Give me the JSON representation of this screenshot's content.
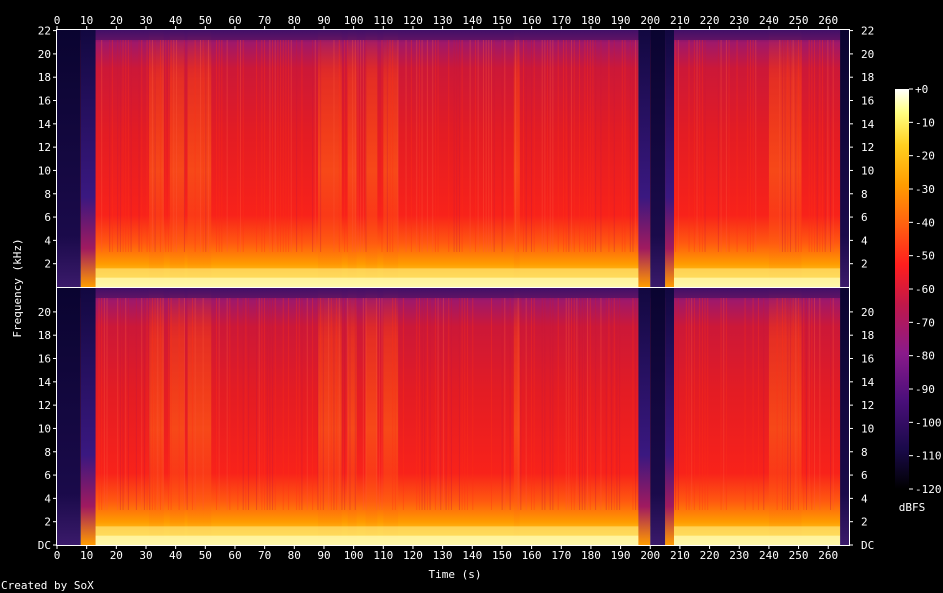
{
  "chart_data": {
    "type": "heatmap",
    "subtype": "spectrogram",
    "xlabel": "Time (s)",
    "ylabel": "Frequency (kHz)",
    "colorbar_label": "dBFS",
    "credit": "Created by SoX",
    "x_range": [
      0,
      267
    ],
    "y_range_khz": [
      0,
      22.05
    ],
    "x_ticks": [
      0,
      10,
      20,
      30,
      40,
      50,
      60,
      70,
      80,
      90,
      100,
      110,
      120,
      130,
      140,
      150,
      160,
      170,
      180,
      190,
      200,
      210,
      220,
      230,
      240,
      250,
      260
    ],
    "x_tick_labels": [
      "0",
      "10",
      "20",
      "30",
      "40",
      "50",
      "60",
      "70",
      "80",
      "90",
      "100",
      "110",
      "120",
      "130",
      "140",
      "150",
      "160",
      "170",
      "180",
      "190",
      "200",
      "210",
      "220",
      "230",
      "240",
      "250",
      "260"
    ],
    "channel_top_ticks": [
      2,
      4,
      6,
      8,
      10,
      12,
      14,
      16,
      18,
      20,
      22
    ],
    "channel_top_tick_labels": [
      "2",
      "4",
      "6",
      "8",
      "10",
      "12",
      "14",
      "16",
      "18",
      "20",
      "22"
    ],
    "channel_bottom_ticks": [
      0,
      2,
      4,
      6,
      8,
      10,
      12,
      14,
      16,
      18,
      20
    ],
    "channel_bottom_tick_labels": [
      "DC",
      "2",
      "4",
      "6",
      "8",
      "10",
      "12",
      "14",
      "16",
      "18",
      "20"
    ],
    "colorbar_ticks": [
      0,
      -10,
      -20,
      -30,
      -40,
      -50,
      -60,
      -70,
      -80,
      -90,
      -100,
      -110,
      -120
    ],
    "colorbar_tick_labels": [
      "+0",
      "-10",
      "-20",
      "-30",
      "-40",
      "-50",
      "-60",
      "-70",
      "-80",
      "-90",
      "-100",
      "-110",
      "-120"
    ],
    "colorbar_range_db": [
      -120,
      0
    ],
    "colormap": [
      "#000000",
      "#1a0a4a",
      "#4a0f7a",
      "#8a1a8a",
      "#c0184a",
      "#ff1e1e",
      "#ff6010",
      "#ff9c00",
      "#ffd020",
      "#ffff80",
      "#ffffff"
    ],
    "channels": 2,
    "silent_intervals_s": [
      [
        0,
        8
      ],
      [
        200,
        205
      ],
      [
        264,
        267
      ]
    ],
    "quiet_intervals_s": [
      [
        8,
        13
      ],
      [
        196,
        200
      ],
      [
        205,
        208
      ]
    ],
    "bright_bands_s": [
      [
        31,
        36
      ],
      [
        38,
        43
      ],
      [
        44,
        52
      ],
      [
        88,
        96
      ],
      [
        98,
        101
      ],
      [
        104,
        108
      ],
      [
        110,
        115
      ],
      [
        154,
        156
      ],
      [
        240,
        251
      ]
    ]
  }
}
